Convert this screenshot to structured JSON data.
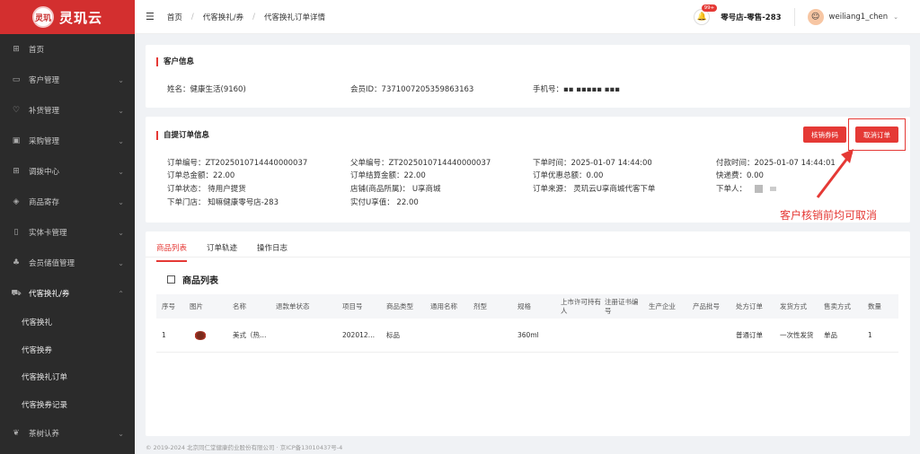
{
  "brand": {
    "name": "灵玑云",
    "logo_text": "灵玑"
  },
  "sidebar": {
    "items": [
      {
        "label": "首页",
        "icon": "grid-icon",
        "has_chevron": false
      },
      {
        "label": "客户管理",
        "icon": "customer-icon",
        "has_chevron": true
      },
      {
        "label": "补货管理",
        "icon": "heart-icon",
        "has_chevron": true
      },
      {
        "label": "采购管理",
        "icon": "cart-box-icon",
        "has_chevron": true
      },
      {
        "label": "调拨中心",
        "icon": "grid-icon",
        "has_chevron": true
      },
      {
        "label": "商品寄存",
        "icon": "cube-icon",
        "has_chevron": true
      },
      {
        "label": "实体卡管理",
        "icon": "book-icon",
        "has_chevron": true
      },
      {
        "label": "会员储值管理",
        "icon": "people-icon",
        "has_chevron": true
      },
      {
        "label": "代客换礼/券",
        "icon": "cart-icon",
        "has_chevron": true
      }
    ],
    "submenu": [
      "代客换礼",
      "代客换券",
      "代客换礼订单",
      "代客换券记录"
    ],
    "last_item": {
      "label": "茶树认养",
      "icon": "leaf-icon"
    }
  },
  "header": {
    "breadcrumb": [
      "首页",
      "代客换礼/券",
      "代客换礼订单详情"
    ],
    "badge": "99+",
    "store": "零号店-零售-283",
    "username": "weiliang1_chen"
  },
  "customer": {
    "title": "客户信息",
    "name": "姓名：健康生活(9160)",
    "member_id": "会员ID：7371007205359863163",
    "phone": "手机号：▪▪ ▪▪▪▪▪ ▪▪▪"
  },
  "order": {
    "title": "自提订单信息",
    "verify_btn": "核销券码",
    "cancel_btn": "取消订单",
    "fields": {
      "order_no": "订单编号：ZT2025010714440000037",
      "parent_no": "父单编号：ZT2025010714440000037",
      "order_time": "下单时间：2025-01-07 14:44:00",
      "pay_time": "付款时间：2025-01-07 14:44:01",
      "total": "订单总金额：22.00",
      "settle": "订单结算金额：22.00",
      "discount": "订单优惠总额：0.00",
      "shipping": "快递费：0.00",
      "status": "订单状态：  待用户提货",
      "shop": "店铺(商品所属)：  U享商城",
      "source": "订单来源：  灵玑云U享商城代客下单",
      "orderer": "下单人：",
      "store": "下单门店：  知嘛健康零号店-283",
      "paid_u": "实付U享值：  22.00"
    }
  },
  "annotation": {
    "text": "客户核销前均可取消"
  },
  "tabs": [
    "商品列表",
    "订单轨迹",
    "操作日志"
  ],
  "products": {
    "title": "商品列表",
    "headers": [
      "序号",
      "图片",
      "名称",
      "退款单状态",
      "项目号",
      "商品类型",
      "通用名称",
      "剂型",
      "规格",
      "上市许可持有人",
      "注册证书编号",
      "生产企业",
      "产品批号",
      "处方订单",
      "发货方式",
      "售卖方式",
      "数量"
    ],
    "rows": [
      [
        "1",
        "",
        "美式（热…",
        "",
        "202012…",
        "标品",
        "",
        "",
        "360ml",
        "",
        "",
        "",
        "",
        "普通订单",
        "一次性发货",
        "单品",
        "1"
      ]
    ]
  },
  "footer": "© 2019-2024 北京同仁堂健康药业股份有限公司 · 京ICP备13010437号-4"
}
